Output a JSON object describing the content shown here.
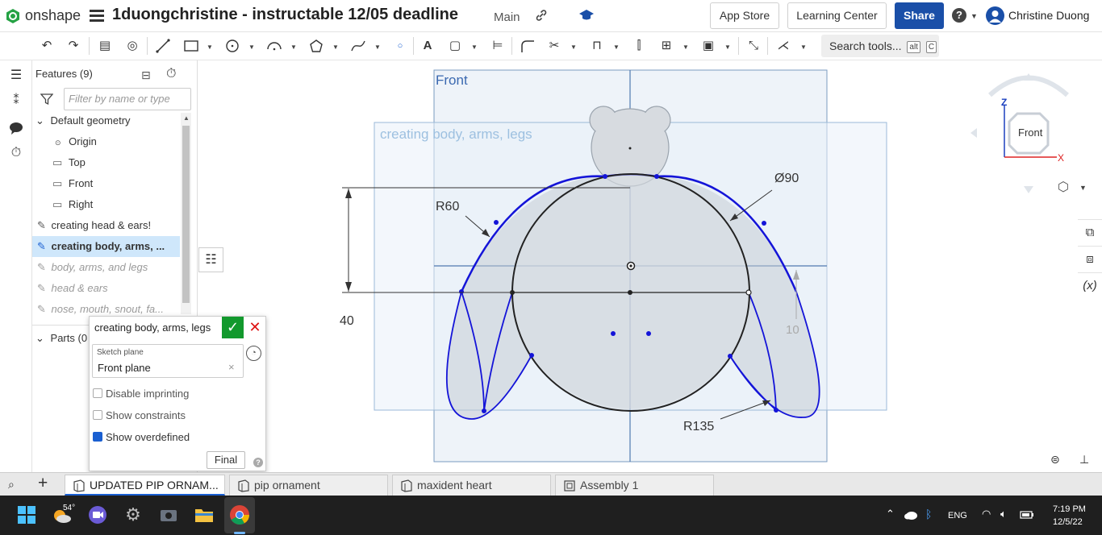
{
  "header": {
    "logo_text": "onshape",
    "document_title": "1duongchristine - instructable 12/05 deadline",
    "workspace": "Main",
    "app_store": "App Store",
    "learning_center": "Learning Center",
    "share": "Share",
    "help": "?",
    "user_name": "Christine Duong"
  },
  "toolbar": {
    "search_placeholder": "Search tools...",
    "search_shortcut_1": "alt",
    "search_shortcut_2": "C"
  },
  "features_panel": {
    "title": "Features (9)",
    "filter_placeholder": "Filter by name or type",
    "default_geometry": "Default geometry",
    "items": [
      {
        "label": "Origin"
      },
      {
        "label": "Top"
      },
      {
        "label": "Front"
      },
      {
        "label": "Right"
      }
    ],
    "features": [
      {
        "label": "creating head & ears!"
      },
      {
        "label": "creating body, arms, ..."
      },
      {
        "label": "body, arms, and legs"
      },
      {
        "label": "head & ears"
      },
      {
        "label": "nose, mouth, snout, fa..."
      }
    ],
    "parts": "Parts (0"
  },
  "sketch_dialog": {
    "title": "creating body, arms, legs",
    "plane_label": "Sketch plane",
    "plane_value": "Front plane",
    "options": [
      {
        "label": "Disable imprinting",
        "checked": false
      },
      {
        "label": "Show constraints",
        "checked": false
      },
      {
        "label": "Show overdefined",
        "checked": true
      }
    ],
    "final_button": "Final",
    "help": "?"
  },
  "viewport": {
    "plane_front": "Front",
    "plane_sketch": "creating body, arms, legs",
    "dim_diameter": "Ø90",
    "dim_r60": "R60",
    "dim_40": "40",
    "dim_10": "10",
    "dim_r135": "R135",
    "view_cube_label": "Front",
    "axis_z": "Z",
    "axis_x": "X"
  },
  "tabs": [
    {
      "label": "UPDATED PIP ORNAM...",
      "active": true
    },
    {
      "label": "pip ornament",
      "active": false
    },
    {
      "label": "maxident heart",
      "active": false
    },
    {
      "label": "Assembly 1",
      "active": false
    }
  ],
  "taskbar": {
    "weather": "54°",
    "language": "ENG",
    "time": "7:19 PM",
    "date": "12/5/22"
  },
  "colors": {
    "accent": "#1a4fa8",
    "sketch_blue": "#1414d8",
    "confirm_green": "#12992d"
  }
}
